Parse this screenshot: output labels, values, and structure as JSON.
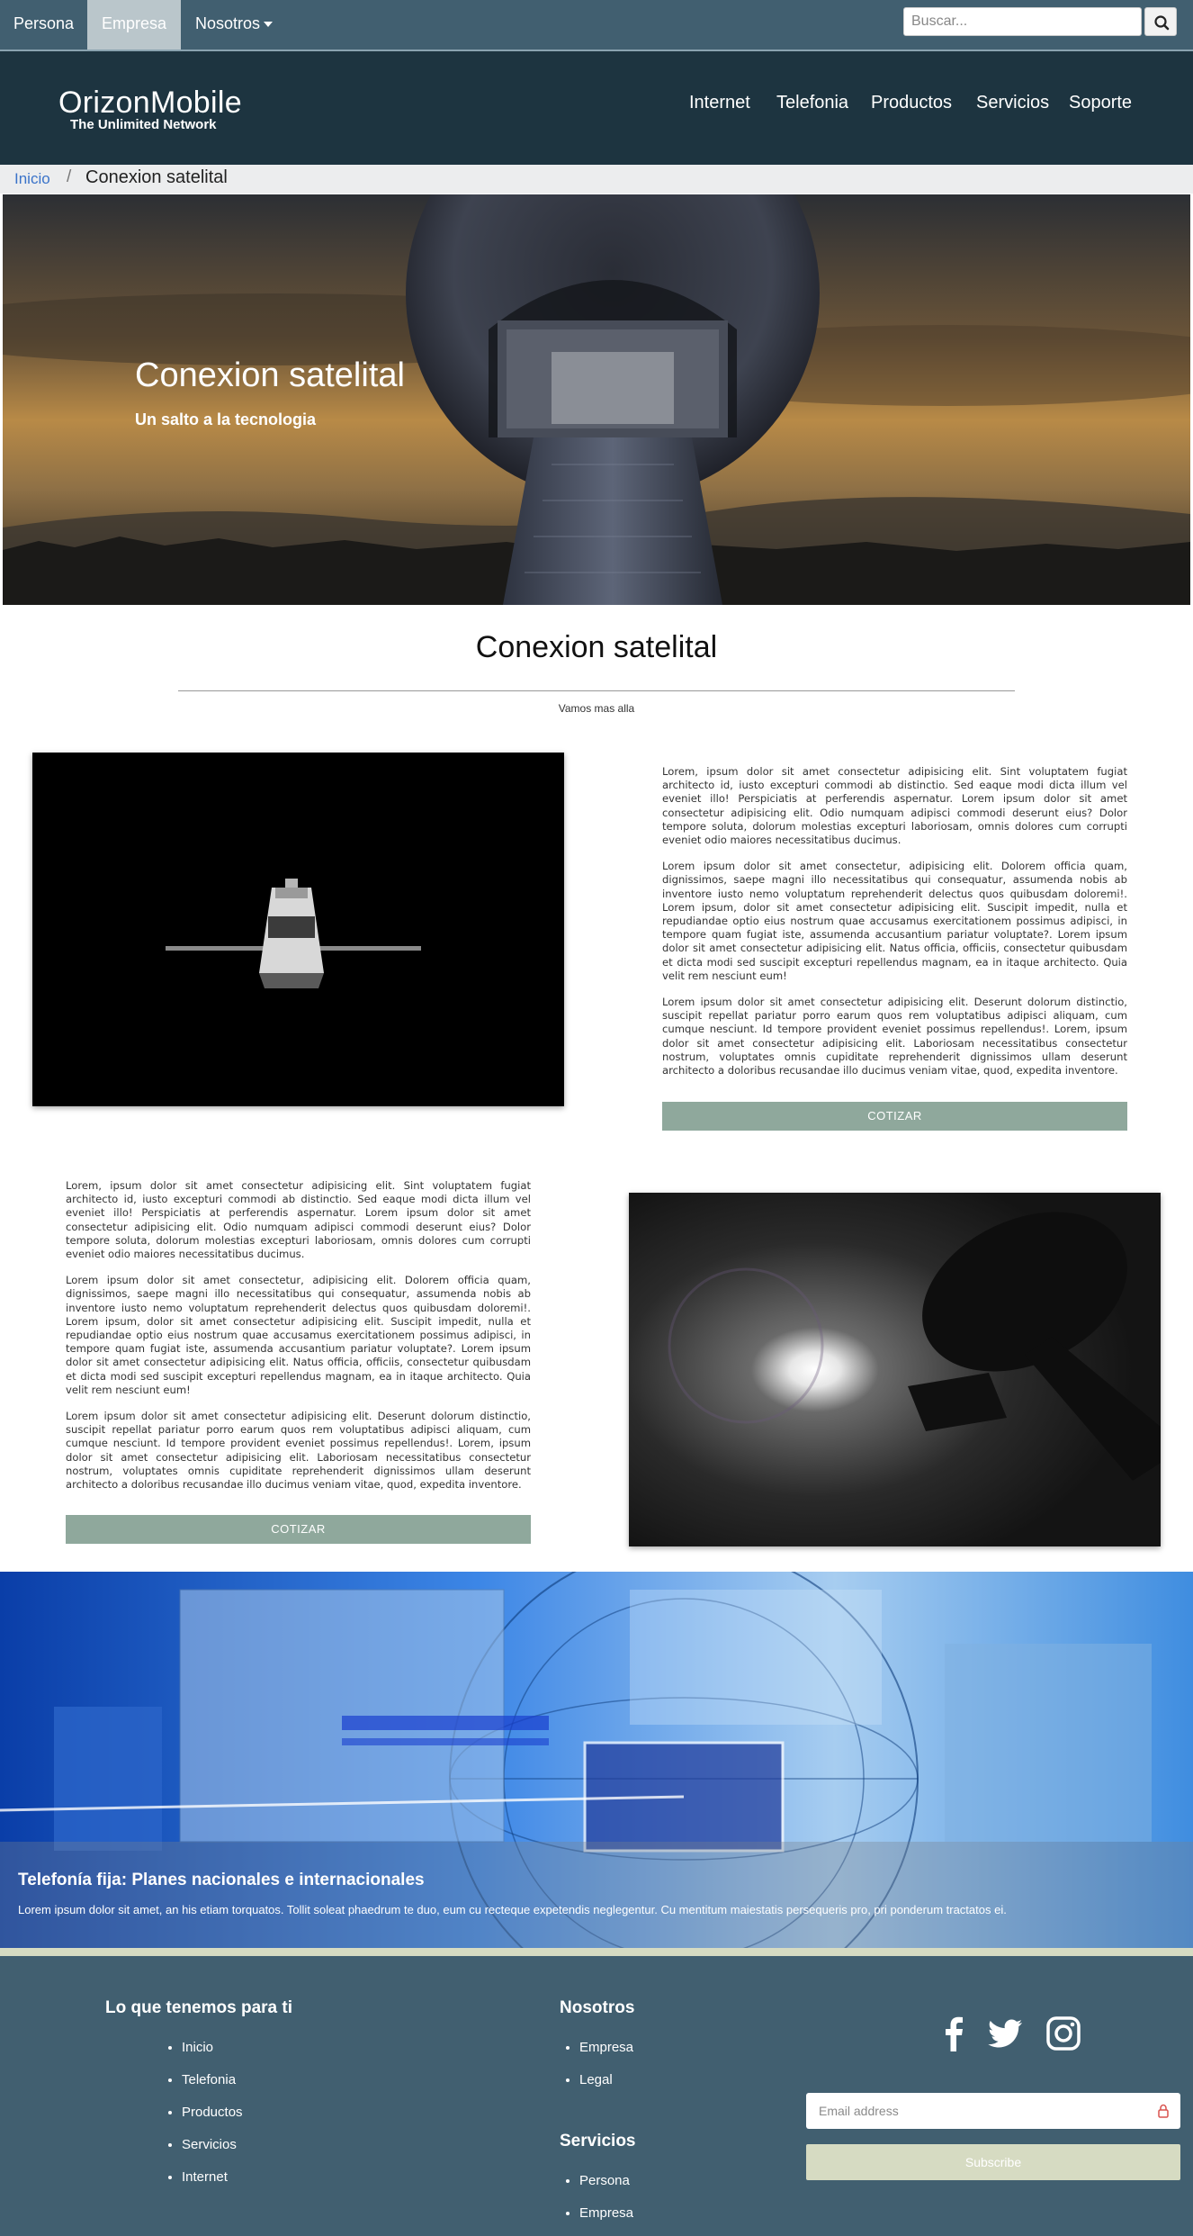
{
  "topbar": {
    "items": [
      {
        "label": "Persona"
      },
      {
        "label": "Empresa",
        "active": true
      },
      {
        "label": "Nosotros"
      }
    ],
    "search_placeholder": "Buscar..."
  },
  "header": {
    "logo": "OrizonMobile",
    "tagline": "The Unlimited Network",
    "nav": [
      "Internet",
      "Telefonia",
      "Productos",
      "Servicios",
      "Soporte"
    ]
  },
  "breadcrumb": {
    "home": "Inicio",
    "separator": "/",
    "current": "Conexion satelital"
  },
  "hero": {
    "title": "Conexion satelital",
    "subtitle": "Un salto a la tecnologia"
  },
  "section": {
    "title": "Conexion satelital",
    "subtitle": "Vamos mas alla"
  },
  "block1": {
    "paragraphs": [
      "Lorem, ipsum dolor sit amet consectetur adipisicing elit. Sint voluptatem fugiat architecto id, iusto excepturi commodi ab distinctio. Sed eaque modi dicta illum vel eveniet illo! Perspiciatis at perferendis aspernatur. Lorem ipsum dolor sit amet consectetur adipisicing elit. Odio numquam adipisci commodi deserunt eius? Dolor tempore soluta, dolorum molestias excepturi laboriosam, omnis dolores cum corrupti eveniet odio maiores necessitatibus ducimus.",
      "Lorem ipsum dolor sit amet consectetur, adipisicing elit. Dolorem officia quam, dignissimos, saepe magni illo necessitatibus qui consequatur, assumenda nobis ab inventore iusto nemo voluptatum reprehenderit delectus quos quibusdam doloremi!. Lorem ipsum, dolor sit amet consectetur adipisicing elit. Suscipit impedit, nulla et repudiandae optio eius nostrum quae accusamus exercitationem possimus adipisci, in tempore quam fugiat iste, assumenda accusantium pariatur voluptate?. Lorem ipsum dolor sit amet consectetur adipisicing elit. Natus officia, officiis, consectetur quibusdam et dicta modi sed suscipit excepturi repellendus magnam, ea in itaque architecto. Quia velit rem nesciunt eum!",
      "Lorem ipsum dolor sit amet consectetur adipisicing elit. Deserunt dolorum distinctio, suscipit repellat pariatur porro earum quos rem voluptatibus adipisci aliquam, cum cumque nesciunt. Id tempore provident eveniet possimus repellendus!. Lorem, ipsum dolor sit amet consectetur adipisicing elit. Laboriosam necessitatibus consectetur nostrum, voluptates omnis cupiditate reprehenderit dignissimos ullam deserunt architecto a doloribus recusandae illo ducimus veniam vitae, quod, expedita inventore."
    ],
    "button": "COTIZAR"
  },
  "block2": {
    "paragraphs": [
      "Lorem, ipsum dolor sit amet consectetur adipisicing elit. Sint voluptatem fugiat architecto id, iusto excepturi commodi ab distinctio. Sed eaque modi dicta illum vel eveniet illo! Perspiciatis at perferendis aspernatur. Lorem ipsum dolor sit amet consectetur adipisicing elit. Odio numquam adipisci commodi deserunt eius? Dolor tempore soluta, dolorum molestias excepturi laboriosam, omnis dolores cum corrupti eveniet odio maiores necessitatibus ducimus.",
      "Lorem ipsum dolor sit amet consectetur, adipisicing elit. Dolorem officia quam, dignissimos, saepe magni illo necessitatibus qui consequatur, assumenda nobis ab inventore iusto nemo voluptatum reprehenderit delectus quos quibusdam doloremi!. Lorem ipsum, dolor sit amet consectetur adipisicing elit. Suscipit impedit, nulla et repudiandae optio eius nostrum quae accusamus exercitationem possimus adipisci, in tempore quam fugiat iste, assumenda accusantium pariatur voluptate?. Lorem ipsum dolor sit amet consectetur adipisicing elit. Natus officia, officiis, consectetur quibusdam et dicta modi sed suscipit excepturi repellendus magnam, ea in itaque architecto. Quia velit rem nesciunt eum!",
      "Lorem ipsum dolor sit amet consectetur adipisicing elit. Deserunt dolorum distinctio, suscipit repellat pariatur porro earum quos rem voluptatibus adipisci aliquam, cum cumque nesciunt. Id tempore provident eveniet possimus repellendus!. Lorem, ipsum dolor sit amet consectetur adipisicing elit. Laboriosam necessitatibus consectetur nostrum, voluptates omnis cupiditate reprehenderit dignissimos ullam deserunt architecto a doloribus recusandae illo ducimus veniam vitae, quod, expedita inventore."
    ],
    "button": "COTIZAR"
  },
  "banner": {
    "title": "Telefonía fija: Planes nacionales e internacionales",
    "text": "Lorem ipsum dolor sit amet, an his etiam torquatos. Tollit soleat phaedrum te duo, eum cu recteque expetendis neglegentur. Cu mentitum maiestatis persequeris pro, pri ponderum tractatos ei."
  },
  "footer": {
    "col1": {
      "title": "Lo que tenemos para ti",
      "items": [
        "Inicio",
        "Telefonia",
        "Productos",
        "Servicios",
        "Internet"
      ]
    },
    "col2": {
      "title": "Nosotros",
      "items": [
        "Empresa",
        "Legal"
      ]
    },
    "col3": {
      "title": "Servicios",
      "items": [
        "Persona",
        "Empresa"
      ]
    },
    "social": [
      "facebook-icon",
      "twitter-icon",
      "instagram-icon"
    ],
    "email_placeholder": "Email address",
    "subscribe": "Subscribe"
  },
  "colors": {
    "topbar": "#415f70",
    "header": "#1d3440",
    "button": "#8fa89c",
    "footer": "#415f70",
    "subscribe": "#d6dbc2"
  }
}
